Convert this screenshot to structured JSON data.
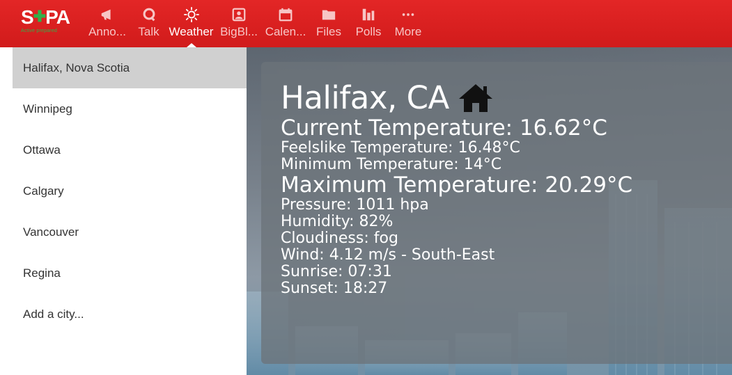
{
  "header": {
    "logo_text_left": "S",
    "logo_text_right": "PA",
    "logo_tagline": "Active prepared",
    "nav": [
      {
        "label": "Anno...",
        "icon": "megaphone-icon"
      },
      {
        "label": "Talk",
        "icon": "talk-bubble-icon"
      },
      {
        "label": "Weather",
        "icon": "sun-icon",
        "active": true
      },
      {
        "label": "BigBl...",
        "icon": "bigbluebutton-icon"
      },
      {
        "label": "Calen...",
        "icon": "calendar-icon"
      },
      {
        "label": "Files",
        "icon": "folder-icon"
      },
      {
        "label": "Polls",
        "icon": "bar-chart-icon"
      },
      {
        "label": "More",
        "icon": "more-dots-icon"
      }
    ],
    "colors": {
      "header_red": "#e02020",
      "logo_green": "#2fb14a",
      "inactive_label": "#f7c5c5"
    }
  },
  "sidebar": {
    "cities": [
      {
        "label": "Halifax, Nova Scotia",
        "selected": true
      },
      {
        "label": "Winnipeg"
      },
      {
        "label": "Ottawa"
      },
      {
        "label": "Calgary"
      },
      {
        "label": "Vancouver"
      },
      {
        "label": "Regina"
      },
      {
        "label": "Add a city..."
      }
    ]
  },
  "weather": {
    "city": "Halifax, CA",
    "home_icon": "home-icon",
    "current_temp": "Current Temperature: 16.62°C",
    "feels_like": "Feelslike Temperature: 16.48°C",
    "min_temp": "Minimum Temperature: 14°C",
    "max_temp": "Maximum Temperature: 20.29°C",
    "pressure": "Pressure: 1011 hpa",
    "humidity": "Humidity: 82%",
    "cloudiness": "Cloudiness: fog",
    "wind": "Wind: 4.12 m/s - South-East",
    "sunrise": "Sunrise: 07:31",
    "sunset": "Sunset: 18:27"
  }
}
